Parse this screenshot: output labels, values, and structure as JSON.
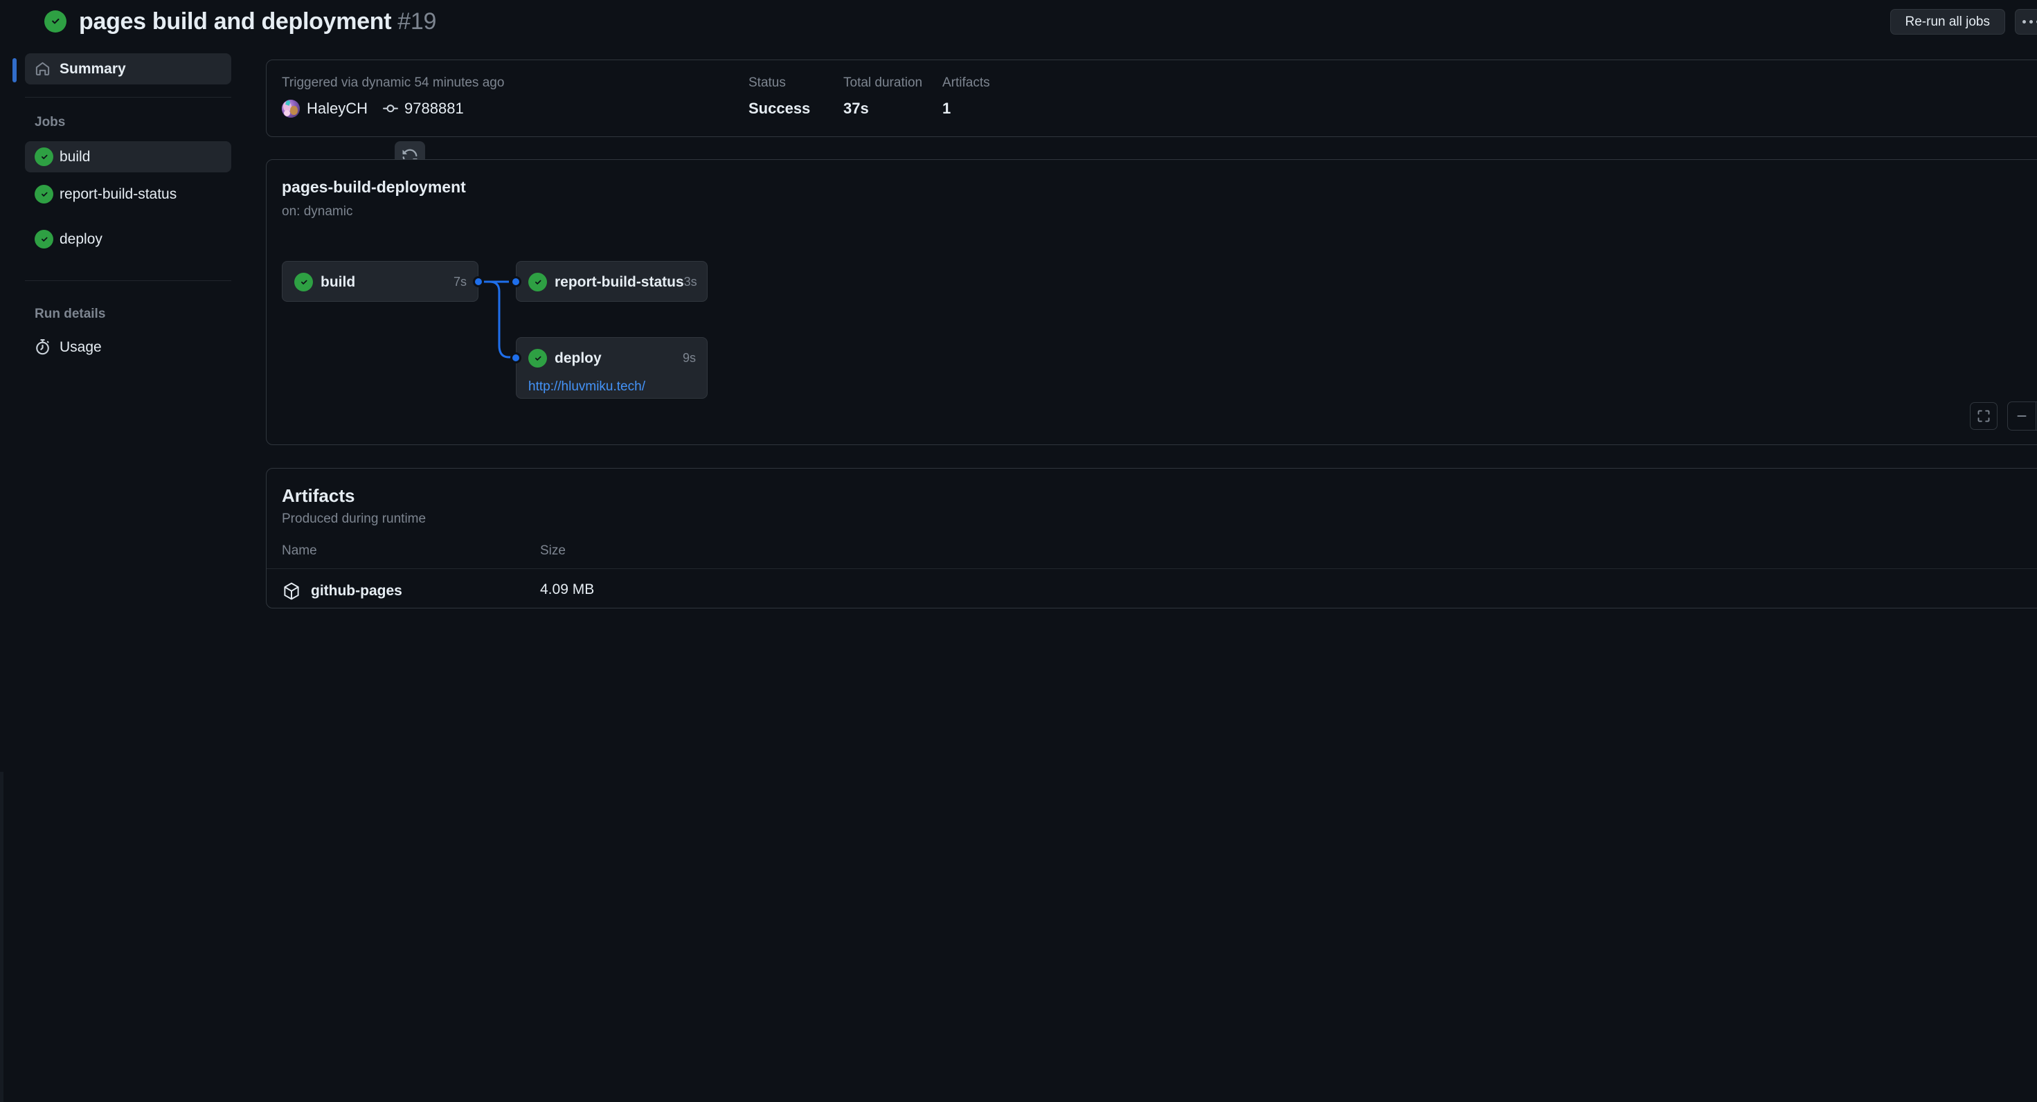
{
  "header": {
    "status_icon": "check-circle-fill-icon",
    "title": "pages build and deployment",
    "run_number": "#19",
    "rerun_all_label": "Re-run all jobs",
    "kebab_icon": "kebab-horizontal-icon"
  },
  "sidebar": {
    "summary": {
      "label": "Summary",
      "icon": "home-icon"
    },
    "jobs_heading": "Jobs",
    "jobs": [
      {
        "label": "build",
        "icon": "check-circle-fill-icon",
        "selected": true,
        "rerun_icon": "sync-icon"
      },
      {
        "label": "report-build-status",
        "icon": "check-circle-fill-icon",
        "selected": false
      },
      {
        "label": "deploy",
        "icon": "check-circle-fill-icon",
        "selected": false
      }
    ],
    "run_details_heading": "Run details",
    "run_details": [
      {
        "label": "Usage",
        "icon": "stopwatch-icon"
      }
    ]
  },
  "summary": {
    "triggered_text": "Triggered via dynamic 54 minutes ago",
    "actor": "HaleyCH",
    "actor_avatar": "user-avatar",
    "commit_icon": "git-commit-icon",
    "commit_sha": "9788881",
    "columns": [
      {
        "label": "Status",
        "value": "Success"
      },
      {
        "label": "Total duration",
        "value": "37s"
      },
      {
        "label": "Artifacts",
        "value": "1"
      }
    ]
  },
  "graph": {
    "title": "pages-build-deployment",
    "subtitle": "on: dynamic",
    "nodes": [
      {
        "id": "build",
        "name": "build",
        "duration": "7s",
        "icon": "check-circle-fill-icon",
        "url": null
      },
      {
        "id": "report-build-status",
        "name": "report-build-status",
        "duration": "3s",
        "icon": "check-circle-fill-icon",
        "url": null
      },
      {
        "id": "deploy",
        "name": "deploy",
        "duration": "9s",
        "icon": "check-circle-fill-icon",
        "url": "http://hluvmiku.tech/"
      }
    ],
    "controls": {
      "fit_icon": "screen-full-icon",
      "zoom_out_icon": "dash-icon",
      "zoom_in_icon": "plus-icon"
    },
    "edge_color": "#1f6feb"
  },
  "artifacts": {
    "title": "Artifacts",
    "subtitle": "Produced during runtime",
    "columns": [
      "Name",
      "Size"
    ],
    "rows": [
      {
        "name": "github-pages",
        "size": "4.09 MB",
        "icon": "package-icon",
        "delete_icon": "trash-icon"
      }
    ]
  },
  "colors": {
    "bg": "#0d1117",
    "surface": "#21262d",
    "border": "#30363d",
    "text": "#e6edf3",
    "muted": "#7d8590",
    "success": "#2ea043",
    "accent": "#1f6feb",
    "link": "#4493f8"
  }
}
